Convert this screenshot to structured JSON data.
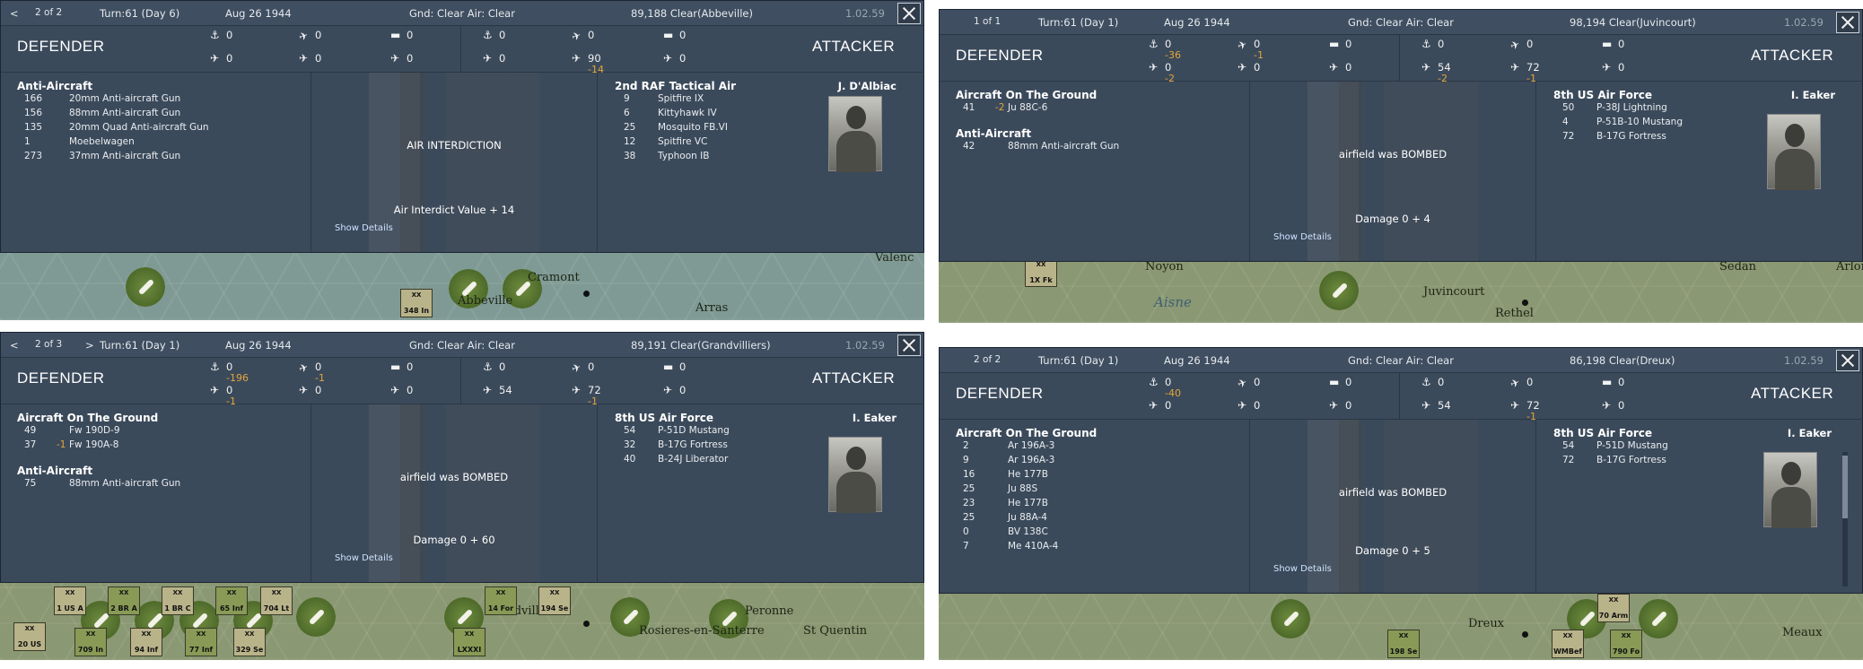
{
  "panels": [
    {
      "nav": {
        "prev": "<",
        "index": "2 of 2",
        "next": ""
      },
      "turn": "Turn:61 (Day 6)",
      "date": "Aug 26 1944",
      "weather": "Gnd: Clear  Air: Clear",
      "location": "89,188  Clear(Abbeville)",
      "version": "1.02.59",
      "defender": {
        "title": "DEFENDER",
        "stats": [
          [
            "0",
            ""
          ],
          [
            "0",
            ""
          ],
          [
            "0",
            ""
          ],
          [
            "0",
            ""
          ],
          [
            "0",
            ""
          ],
          [
            "0",
            ""
          ]
        ]
      },
      "attacker": {
        "title": "ATTACKER",
        "stats": [
          [
            "0",
            ""
          ],
          [
            "0",
            ""
          ],
          [
            "0",
            ""
          ],
          [
            "0",
            ""
          ],
          [
            "90",
            "-14"
          ],
          [
            "0",
            ""
          ]
        ]
      },
      "left_sections": [
        {
          "title": "Anti-Aircraft",
          "rows": [
            {
              "n": "166",
              "d": "",
              "name": "20mm Anti-aircraft Gun"
            },
            {
              "n": "156",
              "d": "",
              "name": "88mm Anti-aircraft Gun"
            },
            {
              "n": "135",
              "d": "",
              "name": "20mm Quad Anti-aircraft Gun"
            },
            {
              "n": "1",
              "d": "",
              "name": "Moebelwagen"
            },
            {
              "n": "273",
              "d": "",
              "name": "37mm Anti-aircraft Gun"
            }
          ]
        }
      ],
      "event": "AIR INTERDICTION",
      "result": "Air Interdict Value  + 14",
      "show_details": "Show Details",
      "force": {
        "title": "2nd RAF Tactical Air",
        "commander": "J. D'Albiac",
        "rows": [
          {
            "n": "9",
            "name": "Spitfire IX"
          },
          {
            "n": "6",
            "name": "Kittyhawk IV"
          },
          {
            "n": "25",
            "name": "Mosquito FB.VI"
          },
          {
            "n": "12",
            "name": "Spitfire VC"
          },
          {
            "n": "38",
            "name": "Typhoon IB"
          }
        ]
      },
      "map_labels": [
        "Valenc",
        "Cramont",
        "Abbeville",
        "Arras",
        "348 In"
      ]
    },
    {
      "nav": {
        "prev": "",
        "index": "1 of 1",
        "next": ""
      },
      "turn": "Turn:61 (Day 1)",
      "date": "Aug 26 1944",
      "weather": "Gnd: Clear  Air: Clear",
      "location": "98,194  Clear(Juvincourt)",
      "version": "1.02.59",
      "defender": {
        "title": "DEFENDER",
        "stats": [
          [
            "0",
            "-36"
          ],
          [
            "0",
            "-1"
          ],
          [
            "0",
            ""
          ],
          [
            "0",
            "-2"
          ],
          [
            "0",
            ""
          ],
          [
            "0",
            ""
          ]
        ]
      },
      "attacker": {
        "title": "ATTACKER",
        "stats": [
          [
            "0",
            ""
          ],
          [
            "0",
            ""
          ],
          [
            "0",
            ""
          ],
          [
            "54",
            "-2"
          ],
          [
            "72",
            "-1"
          ],
          [
            "0",
            ""
          ]
        ]
      },
      "left_sections": [
        {
          "title": "Aircraft On The Ground",
          "rows": [
            {
              "n": "41",
              "d": "-2",
              "name": "Ju 88C-6"
            }
          ]
        },
        {
          "title": "Anti-Aircraft",
          "rows": [
            {
              "n": "42",
              "d": "",
              "name": "88mm Anti-aircraft Gun"
            }
          ]
        }
      ],
      "event": "airfield was BOMBED",
      "result": "Damage  0 + 4",
      "show_details": "Show Details",
      "force": {
        "title": "8th US Air Force",
        "commander": "I. Eaker",
        "rows": [
          {
            "n": "50",
            "name": "P-38J Lightning"
          },
          {
            "n": "4",
            "name": "P-51B-10 Mustang"
          },
          {
            "n": "72",
            "name": "B-17G Fortress"
          }
        ]
      },
      "map_labels": [
        "Noyon",
        "Aisne",
        "Juvincourt",
        "Rethel",
        "Sedan",
        "Arlon",
        "1X Fk"
      ]
    },
    {
      "nav": {
        "prev": "<",
        "index": "2 of 3",
        "next": ">"
      },
      "turn": "Turn:61 (Day 1)",
      "date": "Aug 26 1944",
      "weather": "Gnd: Clear  Air: Clear",
      "location": "89,191  Clear(Grandvilliers)",
      "version": "1.02.59",
      "defender": {
        "title": "DEFENDER",
        "stats": [
          [
            "0",
            "-196"
          ],
          [
            "0",
            "-1"
          ],
          [
            "0",
            ""
          ],
          [
            "0",
            "-1"
          ],
          [
            "0",
            ""
          ],
          [
            "0",
            ""
          ]
        ]
      },
      "attacker": {
        "title": "ATTACKER",
        "stats": [
          [
            "0",
            ""
          ],
          [
            "0",
            ""
          ],
          [
            "0",
            ""
          ],
          [
            "54",
            ""
          ],
          [
            "72",
            "-1"
          ],
          [
            "0",
            ""
          ]
        ]
      },
      "left_sections": [
        {
          "title": "Aircraft On The Ground",
          "rows": [
            {
              "n": "49",
              "d": "",
              "name": "Fw 190D-9"
            },
            {
              "n": "37",
              "d": "-1",
              "name": "Fw 190A-8"
            }
          ]
        },
        {
          "title": "Anti-Aircraft",
          "rows": [
            {
              "n": "75",
              "d": "",
              "name": "88mm Anti-aircraft Gun"
            }
          ]
        }
      ],
      "event": "airfield was BOMBED",
      "result": "Damage  0 + 60",
      "show_details": "Show Details",
      "force": {
        "title": "8th US Air Force",
        "commander": "I. Eaker",
        "rows": [
          {
            "n": "54",
            "name": "P-51D Mustang"
          },
          {
            "n": "32",
            "name": "B-17G Fortress"
          },
          {
            "n": "40",
            "name": "B-24J Liberator"
          }
        ]
      },
      "map_labels": [
        "Grandvilliers",
        "Rosieres-en-Santerre",
        "St Quentin",
        "Peronne",
        "20 US",
        "709 In",
        "94 Inf",
        "77 Inf",
        "329 Se",
        "LXXXI",
        "1 US A",
        "2 BR A",
        "1 BR C",
        "65 Inf",
        "704 Lt",
        "14 For",
        "194 Se"
      ]
    },
    {
      "nav": {
        "prev": "",
        "index": "2 of 2",
        "next": ""
      },
      "turn": "Turn:61 (Day 1)",
      "date": "Aug 26 1944",
      "weather": "Gnd: Clear  Air: Clear",
      "location": "86,198  Clear(Dreux)",
      "version": "1.02.59",
      "defender": {
        "title": "DEFENDER",
        "stats": [
          [
            "0",
            "-40"
          ],
          [
            "0",
            ""
          ],
          [
            "0",
            ""
          ],
          [
            "0",
            ""
          ],
          [
            "0",
            ""
          ],
          [
            "0",
            ""
          ]
        ]
      },
      "attacker": {
        "title": "ATTACKER",
        "stats": [
          [
            "0",
            ""
          ],
          [
            "0",
            ""
          ],
          [
            "0",
            ""
          ],
          [
            "54",
            ""
          ],
          [
            "72",
            "-1"
          ],
          [
            "0",
            ""
          ]
        ]
      },
      "left_sections": [
        {
          "title": "Aircraft On The Ground",
          "rows": [
            {
              "n": "2",
              "d": "",
              "name": "Ar 196A-3"
            },
            {
              "n": "9",
              "d": "",
              "name": "Ar 196A-3"
            },
            {
              "n": "16",
              "d": "",
              "name": "He 177B"
            },
            {
              "n": "25",
              "d": "",
              "name": "Ju 88S"
            },
            {
              "n": "23",
              "d": "",
              "name": "He 177B"
            },
            {
              "n": "25",
              "d": "",
              "name": "Ju 88A-4"
            },
            {
              "n": "0",
              "d": "",
              "name": "BV 138C"
            },
            {
              "n": "7",
              "d": "",
              "name": "Me 410A-4"
            }
          ]
        }
      ],
      "event": "airfield was BOMBED",
      "result": "Damage  0 + 5",
      "show_details": "Show Details",
      "force": {
        "title": "8th US Air Force",
        "commander": "I. Eaker",
        "rows": [
          {
            "n": "54",
            "name": "P-51D Mustang"
          },
          {
            "n": "72",
            "name": "B-17G Fortress"
          }
        ]
      },
      "map_labels": [
        "Meaux",
        "198 Se",
        "WMBef",
        "790 Fo",
        "70 Arm",
        "Dreux"
      ]
    }
  ],
  "stat_icons": [
    "infantry-icon",
    "fighter-icon",
    "tank-icon",
    "bomber-icon",
    "plane-icon",
    "aircraft-icon"
  ],
  "colors": {
    "panel_bg": "#3b4a5b",
    "loss": "#e3a53b",
    "map": "#8a9873"
  }
}
